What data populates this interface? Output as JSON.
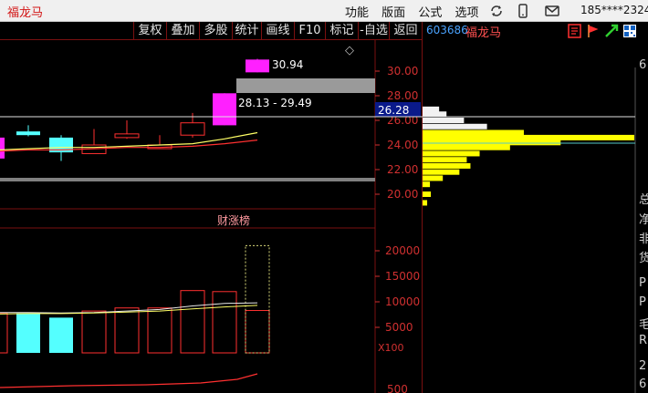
{
  "app": {
    "title": "福龙马"
  },
  "menu": {
    "items": [
      "功能",
      "版面",
      "公式",
      "选项"
    ]
  },
  "user": {
    "label": "185****2324"
  },
  "toolbar": {
    "buttons": [
      "复权",
      "叠加",
      "多股",
      "统计",
      "画线",
      "F10",
      "标记",
      "-自选",
      "返回"
    ]
  },
  "stock": {
    "code": "603686",
    "name": "福龙马",
    "current_price": "26.28"
  },
  "annotations": {
    "high_label": "30.94",
    "range_label": "28.13 - 29.49",
    "event_label": "财涨榜",
    "diamond": "◇",
    "multiplier": "X100"
  },
  "side_text": [
    "6",
    "总",
    "净",
    "非",
    "货",
    "P",
    "P",
    "毛",
    "R",
    "2",
    "6"
  ],
  "colors": {
    "up": "#ff3030",
    "down": "#54ffff",
    "limit_up": "#ff20ff",
    "axis": "#d03030",
    "profile": "#ffff00",
    "grid": "#7a1010"
  },
  "chart_data": {
    "type": "candlestick",
    "price_axis": {
      "ticks": [
        "30.00",
        "28.00",
        "26.00",
        "24.00",
        "22.00",
        "20.00"
      ],
      "range": [
        17.5,
        31.2
      ]
    },
    "volume_axis": {
      "ticks": [
        "20000",
        "15000",
        "10000",
        "5000"
      ],
      "unit": "X100",
      "range": [
        0,
        22000
      ]
    },
    "low_axis": {
      "ticks": [
        "500"
      ]
    },
    "candles": [
      {
        "open": 22.9,
        "close": 24.6,
        "high": 24.6,
        "low": 22.9,
        "dir": "limit_up"
      },
      {
        "open": 25.1,
        "close": 24.8,
        "high": 25.6,
        "low": 24.7,
        "dir": "down"
      },
      {
        "open": 24.6,
        "close": 23.4,
        "high": 24.8,
        "low": 22.7,
        "dir": "down"
      },
      {
        "open": 23.3,
        "close": 24.0,
        "high": 25.3,
        "low": 23.3,
        "dir": "up"
      },
      {
        "open": 24.6,
        "close": 24.9,
        "high": 26.0,
        "low": 24.5,
        "dir": "up"
      },
      {
        "open": 23.7,
        "close": 24.0,
        "high": 24.8,
        "low": 23.7,
        "dir": "up"
      },
      {
        "open": 24.8,
        "close": 25.8,
        "high": 26.6,
        "low": 24.6,
        "dir": "up"
      },
      {
        "open": 25.6,
        "close": 28.2,
        "high": 28.2,
        "low": 25.6,
        "dir": "limit_up"
      },
      {
        "open": 29.9,
        "close": 30.94,
        "high": 31.0,
        "low": 29.9,
        "dir": "limit_up"
      }
    ],
    "ma_short": [
      23.6,
      23.7,
      23.8,
      23.8,
      23.9,
      24.0,
      24.1,
      24.5,
      25.0
    ],
    "ma_long": [
      23.5,
      23.6,
      23.6,
      23.7,
      23.8,
      23.8,
      23.9,
      24.1,
      24.4
    ],
    "volumes": [
      {
        "value": 7800,
        "dir": "up"
      },
      {
        "value": 7800,
        "dir": "down"
      },
      {
        "value": 6900,
        "dir": "down"
      },
      {
        "value": 8200,
        "dir": "up"
      },
      {
        "value": 8800,
        "dir": "up"
      },
      {
        "value": 8800,
        "dir": "up"
      },
      {
        "value": 12200,
        "dir": "up"
      },
      {
        "value": 12000,
        "dir": "up"
      },
      {
        "value": 8300,
        "dir": "up"
      }
    ],
    "volume_ma_a": [
      7900,
      7900,
      7800,
      7900,
      8200,
      8500,
      9200,
      9700,
      9800
    ],
    "volume_ma_b": [
      7600,
      7700,
      7700,
      7800,
      8000,
      8200,
      8600,
      9000,
      9300
    ],
    "projected_volume": 21000,
    "volume_profile": [
      {
        "price": 26.9,
        "width": 18,
        "color": "white"
      },
      {
        "price": 26.5,
        "width": 26,
        "color": "white"
      },
      {
        "price": 26.0,
        "width": 45,
        "color": "white"
      },
      {
        "price": 25.5,
        "width": 70,
        "color": "white"
      },
      {
        "price": 25.0,
        "width": 110,
        "color": "yellow"
      },
      {
        "price": 24.6,
        "width": 230,
        "color": "yellow"
      },
      {
        "price": 24.2,
        "width": 150,
        "color": "yellow"
      },
      {
        "price": 23.8,
        "width": 95,
        "color": "yellow"
      },
      {
        "price": 23.3,
        "width": 62,
        "color": "yellow"
      },
      {
        "price": 22.8,
        "width": 48,
        "color": "yellow"
      },
      {
        "price": 22.3,
        "width": 52,
        "color": "yellow"
      },
      {
        "price": 21.8,
        "width": 40,
        "color": "yellow"
      },
      {
        "price": 21.3,
        "width": 22,
        "color": "yellow"
      },
      {
        "price": 20.8,
        "width": 8,
        "color": "yellow"
      },
      {
        "price": 20.0,
        "width": 9,
        "color": "yellow"
      },
      {
        "price": 19.3,
        "width": 5,
        "color": "yellow"
      }
    ]
  }
}
